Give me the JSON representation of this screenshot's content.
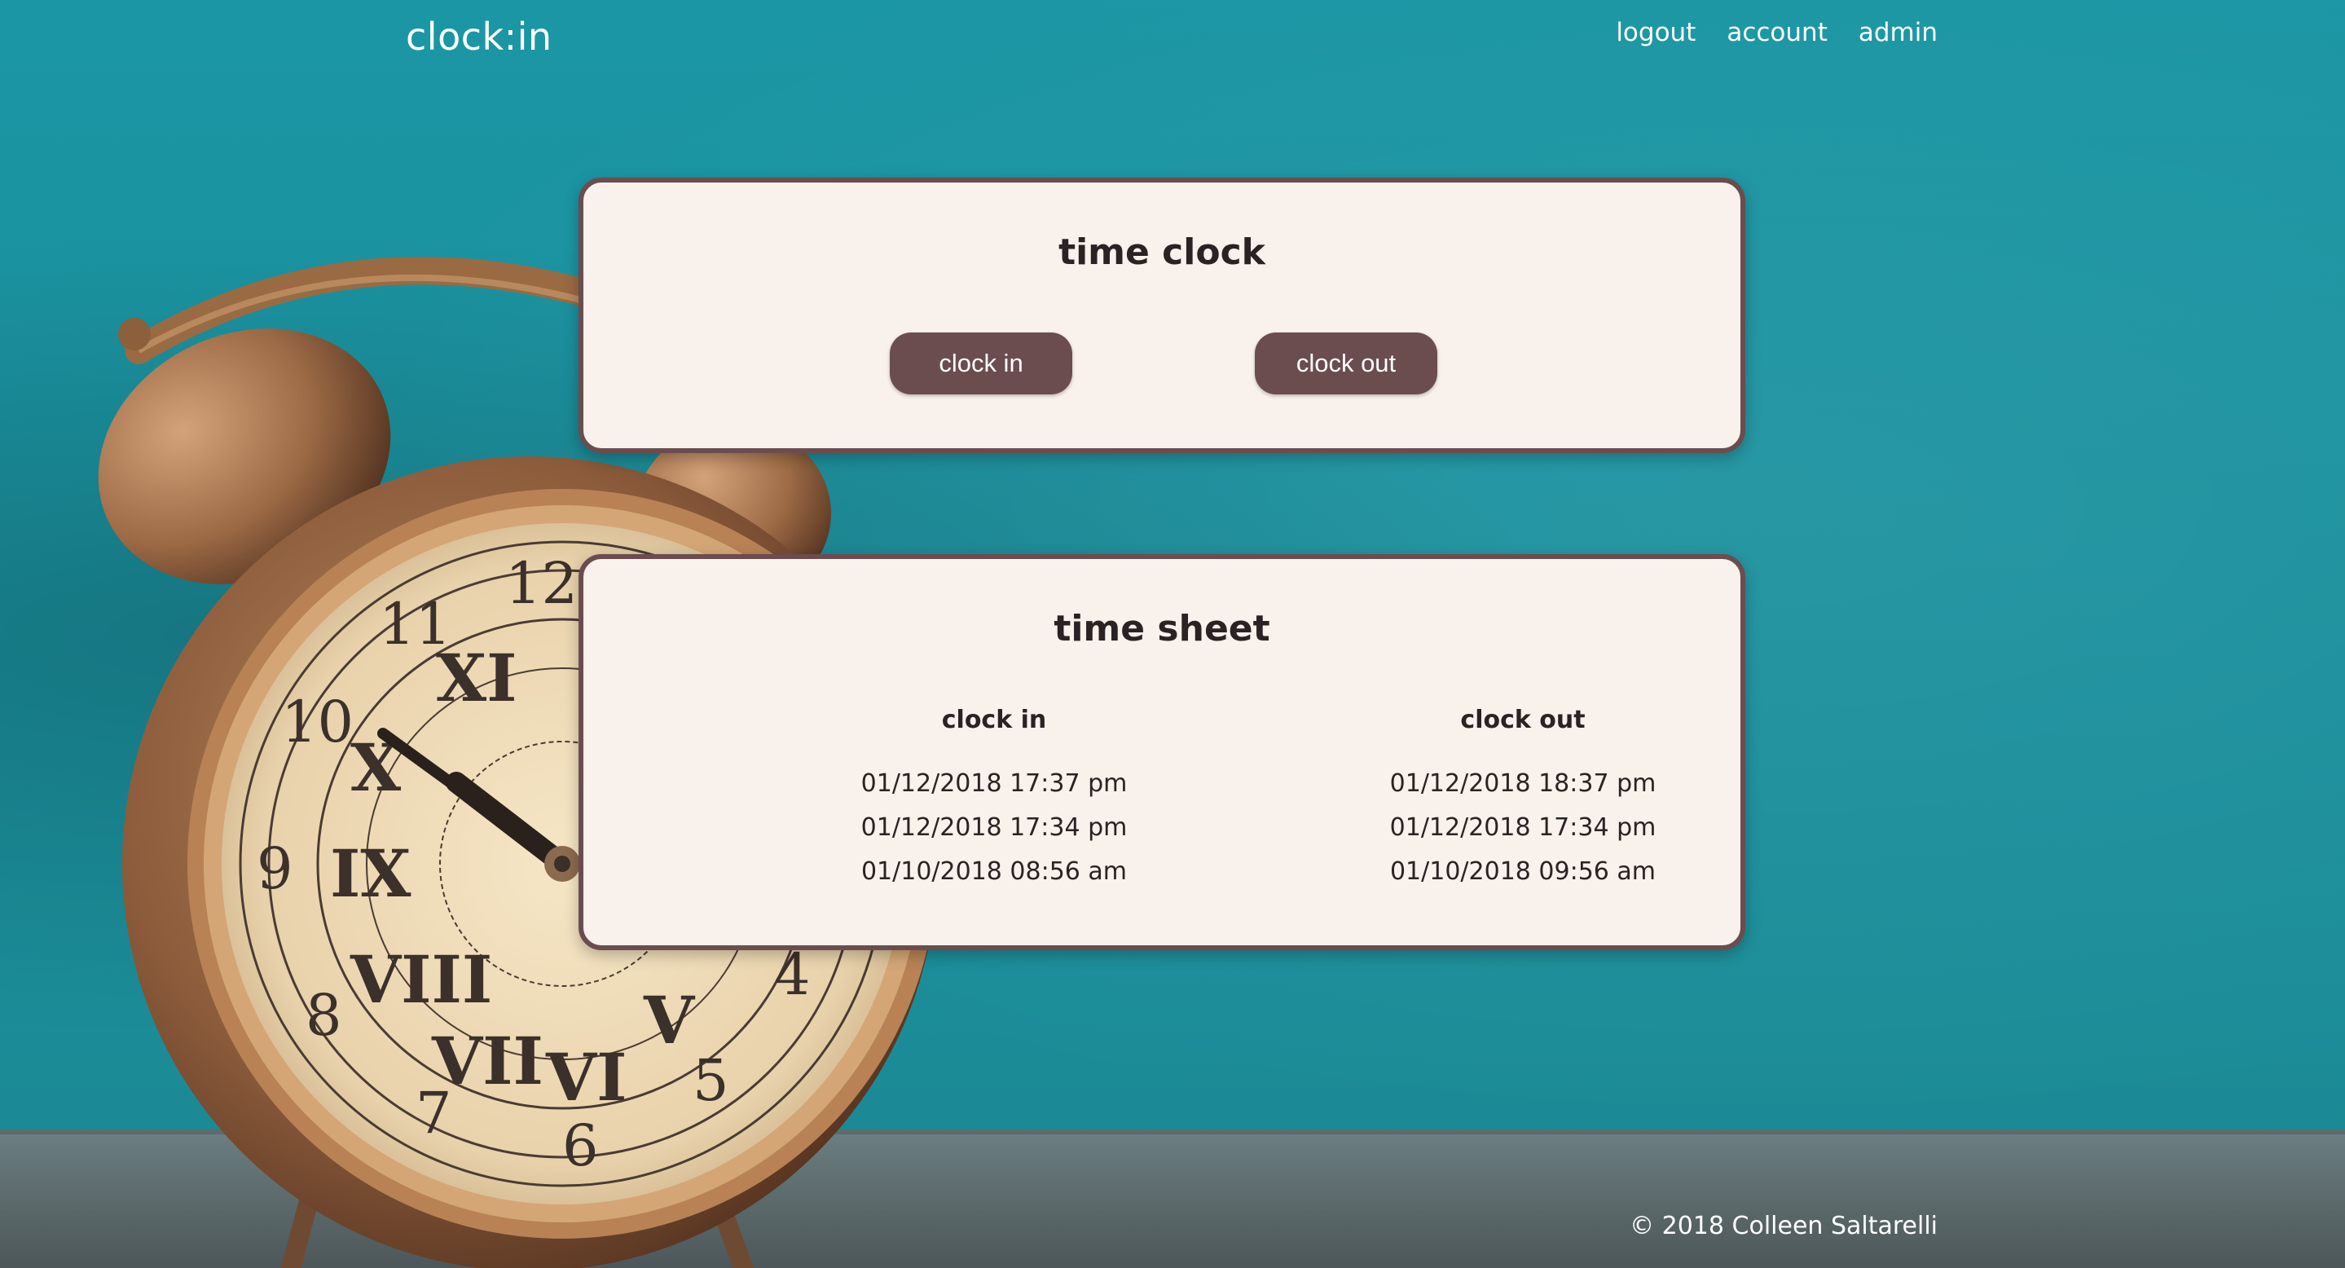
{
  "header": {
    "brand": "clock:in",
    "nav": [
      "logout",
      "account",
      "admin"
    ]
  },
  "time_clock": {
    "title": "time clock",
    "clock_in_label": "clock in",
    "clock_out_label": "clock out"
  },
  "time_sheet": {
    "title": "time sheet",
    "clock_in_header": "clock in",
    "clock_out_header": "clock out",
    "clock_in_values": [
      "01/12/2018 17:37 pm",
      "01/12/2018 17:34 pm",
      "01/10/2018 08:56 am"
    ],
    "clock_out_values": [
      "01/12/2018 18:37 pm",
      "01/12/2018 17:34 pm",
      "01/10/2018 09:56 am"
    ]
  },
  "footer": {
    "copyright": "© 2018 Colleen Saltarelli"
  },
  "colors": {
    "background": "#1b96a4",
    "card": "#f9f1ec",
    "accent": "#6b4d4f",
    "text": "#2a2323"
  }
}
